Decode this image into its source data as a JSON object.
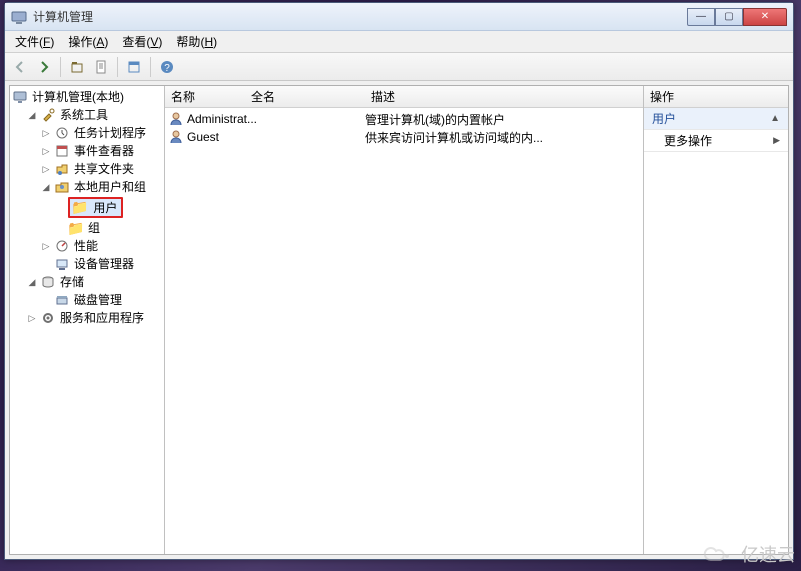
{
  "window": {
    "title": "计算机管理"
  },
  "menubar": {
    "file": {
      "label": "文件",
      "accel": "F"
    },
    "action": {
      "label": "操作",
      "accel": "A"
    },
    "view": {
      "label": "查看",
      "accel": "V"
    },
    "help": {
      "label": "帮助",
      "accel": "H"
    }
  },
  "tree": {
    "root": "计算机管理(本地)",
    "systools": "系统工具",
    "scheduler": "任务计划程序",
    "eventviewer": "事件查看器",
    "shared": "共享文件夹",
    "localusers": "本地用户和组",
    "users": "用户",
    "groups": "组",
    "perf": "性能",
    "devmgr": "设备管理器",
    "storage": "存储",
    "diskmgr": "磁盘管理",
    "services": "服务和应用程序"
  },
  "list": {
    "columns": {
      "name": "名称",
      "full": "全名",
      "desc": "描述"
    },
    "rows": [
      {
        "name": "Administrat...",
        "full": "",
        "desc": "管理计算机(域)的内置帐户"
      },
      {
        "name": "Guest",
        "full": "",
        "desc": "供来宾访问计算机或访问域的内..."
      }
    ]
  },
  "actions": {
    "title": "操作",
    "heading": "用户",
    "more": "更多操作"
  },
  "watermark": "亿速云"
}
